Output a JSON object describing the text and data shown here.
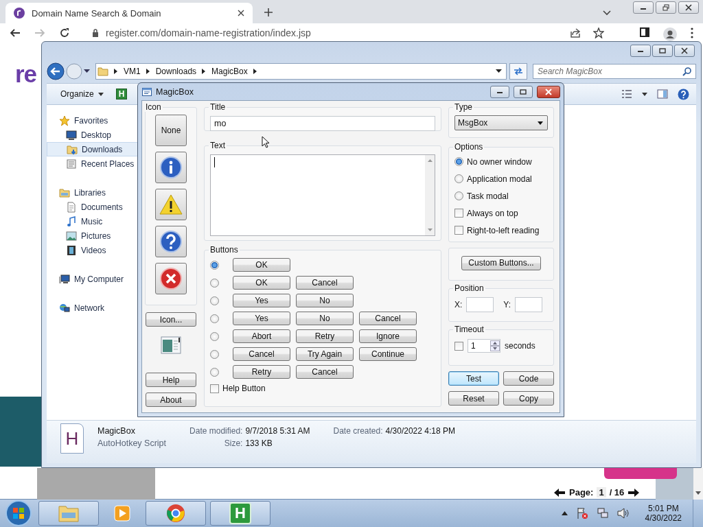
{
  "browser": {
    "tab": {
      "title": "Domain Name Search & Domain",
      "selected": true
    },
    "url": "register.com/domain-name-registration/index.jsp"
  },
  "web_page": {
    "logo": "re",
    "pager": {
      "label": "Page:",
      "current": "1",
      "total": "/ 16"
    }
  },
  "explorer": {
    "breadcrumb": [
      "VM1",
      "Downloads",
      "MagicBox"
    ],
    "search": {
      "placeholder": "Search MagicBox"
    },
    "toolbar": {
      "organize": "Organize",
      "app_letter": "H"
    },
    "nav": [
      {
        "label": "Favorites",
        "selected": false,
        "children": [
          {
            "label": "Desktop",
            "selected": false
          },
          {
            "label": "Downloads",
            "selected": true
          },
          {
            "label": "Recent Places",
            "selected": false
          }
        ]
      },
      {
        "label": "Libraries",
        "selected": false,
        "children": [
          {
            "label": "Documents",
            "selected": false
          },
          {
            "label": "Music",
            "selected": false
          },
          {
            "label": "Pictures",
            "selected": false
          },
          {
            "label": "Videos",
            "selected": false
          }
        ]
      },
      {
        "label": "My Computer",
        "selected": false
      },
      {
        "label": "Network",
        "selected": false
      }
    ],
    "details": {
      "icon_letter": "H",
      "name": "MagicBox",
      "type": "AutoHotkey Script",
      "fields": [
        {
          "label": "Date modified:",
          "value": "9/7/2018 5:31 AM"
        },
        {
          "label": "Size:",
          "value": "133 KB"
        },
        {
          "label": "Date created:",
          "value": "4/30/2022 4:18 PM"
        }
      ]
    }
  },
  "dialog": {
    "title": "MagicBox",
    "icon_group": {
      "label": "Icon",
      "options": [
        {
          "kind": "none",
          "label": "None"
        },
        {
          "kind": "info"
        },
        {
          "kind": "warning"
        },
        {
          "kind": "question"
        },
        {
          "kind": "error"
        }
      ]
    },
    "icon_button": "Icon...",
    "help": "Help",
    "about": "About",
    "title_field": {
      "label": "Title",
      "value": "mo"
    },
    "text_field": {
      "label": "Text"
    },
    "buttons_group": {
      "label": "Buttons",
      "sets": [
        {
          "selected": true,
          "buttons": [
            "OK"
          ]
        },
        {
          "selected": false,
          "buttons": [
            "OK",
            "Cancel"
          ]
        },
        {
          "selected": false,
          "buttons": [
            "Yes",
            "No"
          ]
        },
        {
          "selected": false,
          "buttons": [
            "Yes",
            "No",
            "Cancel"
          ]
        },
        {
          "selected": false,
          "buttons": [
            "Abort",
            "Retry",
            "Ignore"
          ]
        },
        {
          "selected": false,
          "buttons": [
            "Cancel",
            "Try Again",
            "Continue"
          ]
        },
        {
          "selected": false,
          "buttons": [
            "Retry",
            "Cancel"
          ]
        }
      ],
      "help_checkbox": {
        "label": "Help Button",
        "checked": false
      }
    },
    "type": {
      "label": "Type",
      "value": "MsgBox"
    },
    "options": {
      "label": "Options",
      "items": [
        {
          "kind": "radio",
          "label": "No owner window",
          "selected": true
        },
        {
          "kind": "radio",
          "label": "Application modal",
          "selected": false
        },
        {
          "kind": "radio",
          "label": "Task modal",
          "selected": false
        },
        {
          "kind": "checkbox",
          "label": "Always on top",
          "checked": false
        },
        {
          "kind": "checkbox",
          "label": "Right-to-left reading",
          "checked": false
        }
      ]
    },
    "custom_buttons": "Custom Buttons...",
    "position": {
      "label": "Position",
      "x_label": "X:",
      "y_label": "Y:"
    },
    "timeout": {
      "label": "Timeout",
      "checked": false,
      "value": "1",
      "unit": "seconds"
    },
    "actions": [
      {
        "label": "Test",
        "default": true
      },
      {
        "label": "Code",
        "default": false
      },
      {
        "label": "Reset",
        "default": false
      },
      {
        "label": "Copy",
        "default": false
      }
    ]
  },
  "taskbar": {
    "apps": [
      {
        "running": true
      },
      {
        "running": false
      },
      {
        "running": true
      },
      {
        "running": true,
        "letter": "H"
      }
    ],
    "clock": {
      "time": "5:01 PM",
      "date": "4/30/2022"
    }
  }
}
